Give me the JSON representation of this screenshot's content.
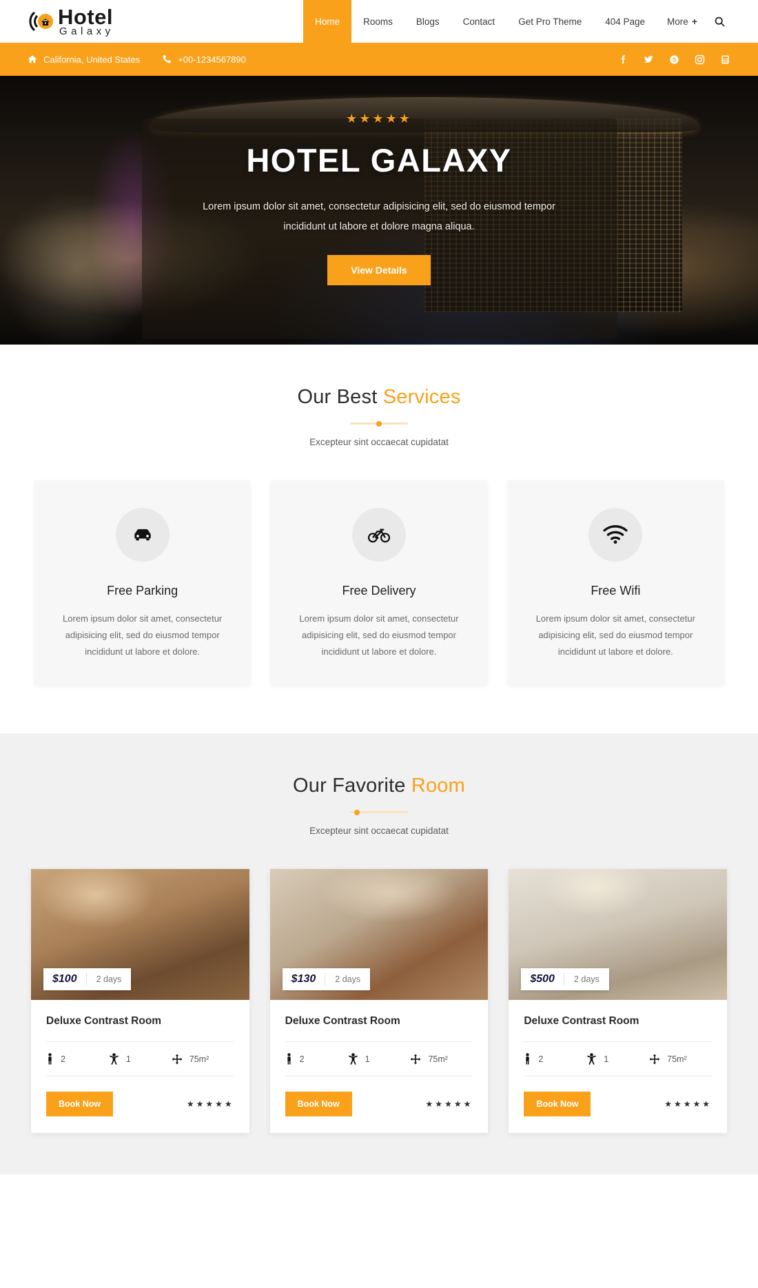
{
  "brand": {
    "name": "Hotel",
    "sub": "Galaxy",
    "logo_icon": "wifi-house-logo-icon"
  },
  "nav": {
    "items": [
      {
        "label": "Home",
        "active": true
      },
      {
        "label": "Rooms",
        "active": false
      },
      {
        "label": "Blogs",
        "active": false
      },
      {
        "label": "Contact",
        "active": false
      },
      {
        "label": "Get Pro Theme",
        "active": false
      },
      {
        "label": "404 Page",
        "active": false
      }
    ],
    "more_label": "More",
    "more_plus": "+",
    "search_icon": "search-icon"
  },
  "infobar": {
    "location": "California, United States",
    "location_icon": "home-icon",
    "phone": "+00-1234567890",
    "phone_icon": "phone-icon",
    "background": "#f9a11b",
    "socials": [
      {
        "name": "facebook-icon",
        "label": "f"
      },
      {
        "name": "twitter-icon",
        "label": "t"
      },
      {
        "name": "skype-icon",
        "label": "s"
      },
      {
        "name": "instagram-icon",
        "label": "i"
      },
      {
        "name": "youtube-icon",
        "label": "y"
      }
    ]
  },
  "hero": {
    "stars": "★★★★★",
    "title": "HOTEL GALAXY",
    "subtitle": "Lorem ipsum dolor sit amet, consectetur adipisicing elit, sed do eiusmod tempor incididunt ut labore et dolore magna aliqua.",
    "button_label": "View Details"
  },
  "services": {
    "title_plain": "Our Best ",
    "title_highlight": "Services",
    "subtitle": "Excepteur sint occaecat cupidatat",
    "divider_dot": "center",
    "cards": [
      {
        "icon": "car-icon",
        "title": "Free Parking",
        "desc": "Lorem ipsum dolor sit amet, consectetur adipisicing elit, sed do eiusmod tempor incididunt ut labore et dolore."
      },
      {
        "icon": "bicycle-icon",
        "title": "Free Delivery",
        "desc": "Lorem ipsum dolor sit amet, consectetur adipisicing elit, sed do eiusmod tempor incididunt ut labore et dolore."
      },
      {
        "icon": "wifi-icon",
        "title": "Free Wifi",
        "desc": "Lorem ipsum dolor sit amet, consectetur adipisicing elit, sed do eiusmod tempor incididunt ut labore et dolore."
      }
    ]
  },
  "rooms": {
    "title_plain": "Our Favorite ",
    "title_highlight": "Room",
    "subtitle": "Excepteur sint occaecat cupidatat",
    "divider_dot": "left",
    "cards": [
      {
        "price": "$100",
        "days": "2 days",
        "title": "Deluxe Contrast Room",
        "adults": "2",
        "children": "1",
        "area": "75m²",
        "button_label": "Book Now",
        "stars": "★★★★★"
      },
      {
        "price": "$130",
        "days": "2 days",
        "title": "Deluxe Contrast Room",
        "adults": "2",
        "children": "1",
        "area": "75m²",
        "button_label": "Book Now",
        "stars": "★★★★★"
      },
      {
        "price": "$500",
        "days": "2 days",
        "title": "Deluxe Contrast Room",
        "adults": "2",
        "children": "1",
        "area": "75m²",
        "button_label": "Book Now",
        "stars": "★★★★★"
      }
    ],
    "spec_icons": {
      "adults": "adult-person-icon",
      "children": "child-person-icon",
      "area": "arrows-expand-icon"
    }
  },
  "colors": {
    "accent": "#f9a11b",
    "section_grey": "#f1f1f1",
    "text_dark": "#2d2d2d"
  }
}
